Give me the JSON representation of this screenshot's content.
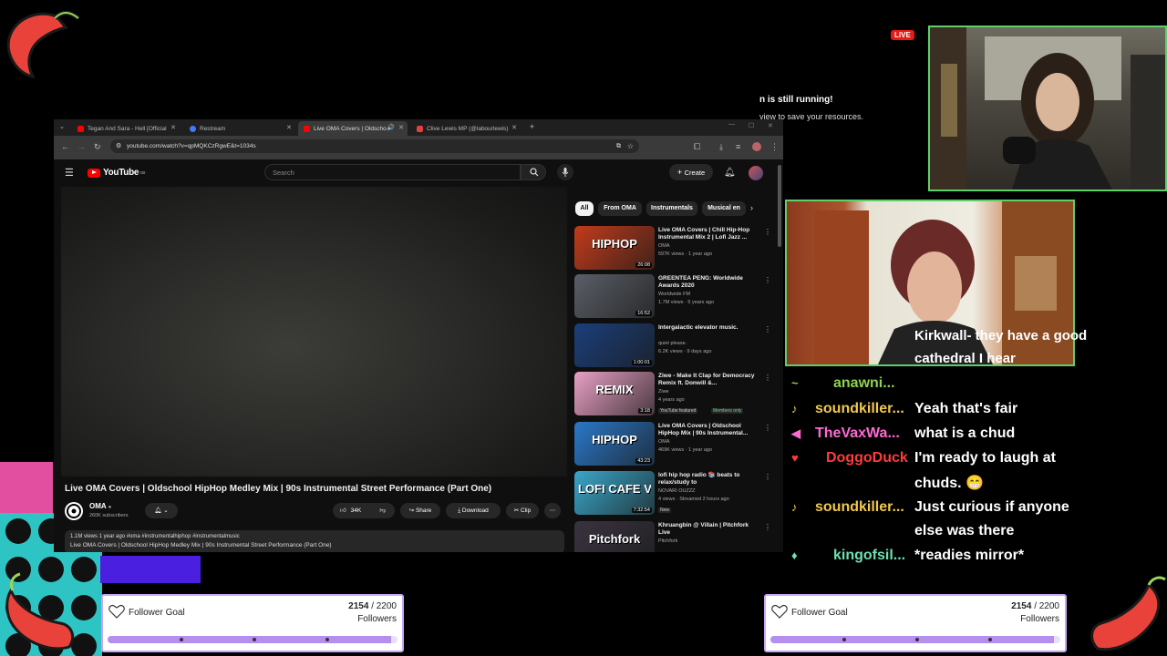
{
  "browser": {
    "tabs": [
      {
        "label": "Tegan And Sara - Hell [Official ",
        "icon_color": "#ff0000"
      },
      {
        "label": "Restream",
        "icon_color": "#3f7bf7"
      },
      {
        "label": "Live OMA Covers | Oldscho",
        "icon_color": "#ff0000"
      },
      {
        "label": "Clive Lewis MP (@labourlewis)",
        "icon_color": "#e04040"
      }
    ],
    "url": "youtube.com/watch?v=qpMQKCzRgwE&t=1034s"
  },
  "youtube": {
    "logo": "YouTube",
    "country": "GB",
    "search_placeholder": "Search",
    "create_label": "Create",
    "video_title": "Live OMA Covers | Oldschool HipHop Medley Mix | 90s Instrumental Street Performance (Part One)",
    "channel": "OMA",
    "subscribers": "260K subscribers",
    "likes": "34K",
    "share_label": "Share",
    "download_label": "Download",
    "clip_label": "Clip",
    "desc_meta": "1.1M views  1 year ago  #oma #instrumentalhiphop #instrumentalmusic",
    "desc_text": "Live OMA Covers | Oldschool HipHop Medley Mix | 90s Instrumental Street Performance (Part One)",
    "chips": [
      "All",
      "From OMA",
      "Instrumentals",
      "Musical en"
    ],
    "recommendations": [
      {
        "title": "Live OMA Covers | Chill Hip-Hop Instrumental Mix 2 | Lofi Jazz ...",
        "channel": "OMA",
        "meta": "597K views · 1 year ago",
        "duration": "26:08",
        "thumb_text": "HIPHOP",
        "thumb_bg": "#c23b1b"
      },
      {
        "title": "GREENTEA PENG: Worldwide Awards 2020",
        "channel": "Worldwide FM",
        "meta": "1.7M views · 5 years ago",
        "duration": "16:52",
        "thumb_text": "",
        "thumb_bg": "#5a5e66"
      },
      {
        "title": "Intergalactic elevator music.",
        "channel": "quiet please.",
        "meta": "6.2K views · 9 days ago",
        "duration": "1:00:01",
        "thumb_text": "",
        "thumb_bg": "#1b3f7a"
      },
      {
        "title": "Ziwe - Make It Clap for Democracy Remix ft. Donwill &...",
        "channel": "Ziwe",
        "meta": "4 years ago",
        "duration": "3:18",
        "thumb_text": "REMIX",
        "thumb_bg": "#e8a0c4",
        "badge1": "YouTube featured",
        "badge2": "Members only"
      },
      {
        "title": "Live OMA Covers | Oldschool HipHop Mix | 90s Instrumental...",
        "channel": "OMA",
        "meta": "469K views · 1 year ago",
        "duration": "43:23",
        "thumb_text": "HIPHOP",
        "thumb_bg": "#2a78c8"
      },
      {
        "title": "lofi hip hop radio 📚 beats to relax/study to",
        "channel": "NOVARI OUZZZ",
        "meta": "4 views · Streamed 2 hours ago",
        "duration": "7:32:54",
        "thumb_text": "LOFI CAFE VIBES",
        "thumb_bg": "#3aa6c9",
        "badge1": "New"
      },
      {
        "title": "Khruangbin @ Villain | Pitchfork Live",
        "channel": "Pitchfork",
        "meta": "",
        "duration": "",
        "thumb_text": "Pitchfork",
        "thumb_bg": "#3a3340"
      }
    ]
  },
  "overlay": {
    "notice_line1": "n is still running!",
    "notice_line2": "view to save your resources.",
    "live_badge": "LIVE",
    "caption": "Kirkwall- they have a good cathedral I hear",
    "caption_line1": "Kirkwall- they have a good",
    "caption_line2": "cathedral I hear",
    "chat": [
      {
        "user": "anawni...",
        "color": "#8fd14f",
        "message": ""
      },
      {
        "user": "soundkiller...",
        "color": "#f2c94c",
        "message": "Yeah that's fair"
      },
      {
        "user": "TheVaxWa...",
        "color": "#ff69d4",
        "message": "what is a chud"
      },
      {
        "user": "DoggoDuck",
        "color": "#ff3b3b",
        "message": "I'm ready to laugh at",
        "message2": "chuds. 😁"
      },
      {
        "user": "soundkiller...",
        "color": "#f2c94c",
        "message": "Just curious if anyone",
        "message2": "else was there"
      },
      {
        "user": "kingofsil...",
        "color": "#6fe0b0",
        "message": "*readies mirror*"
      }
    ]
  },
  "goals": [
    {
      "title": "Follower Goal",
      "current": "2154",
      "target": "/ 2200",
      "unit": "Followers",
      "progress": 0.979
    },
    {
      "title": "Follower Goal",
      "current": "2154",
      "target": "/ 2200",
      "unit": "Followers",
      "progress": 0.979
    }
  ]
}
